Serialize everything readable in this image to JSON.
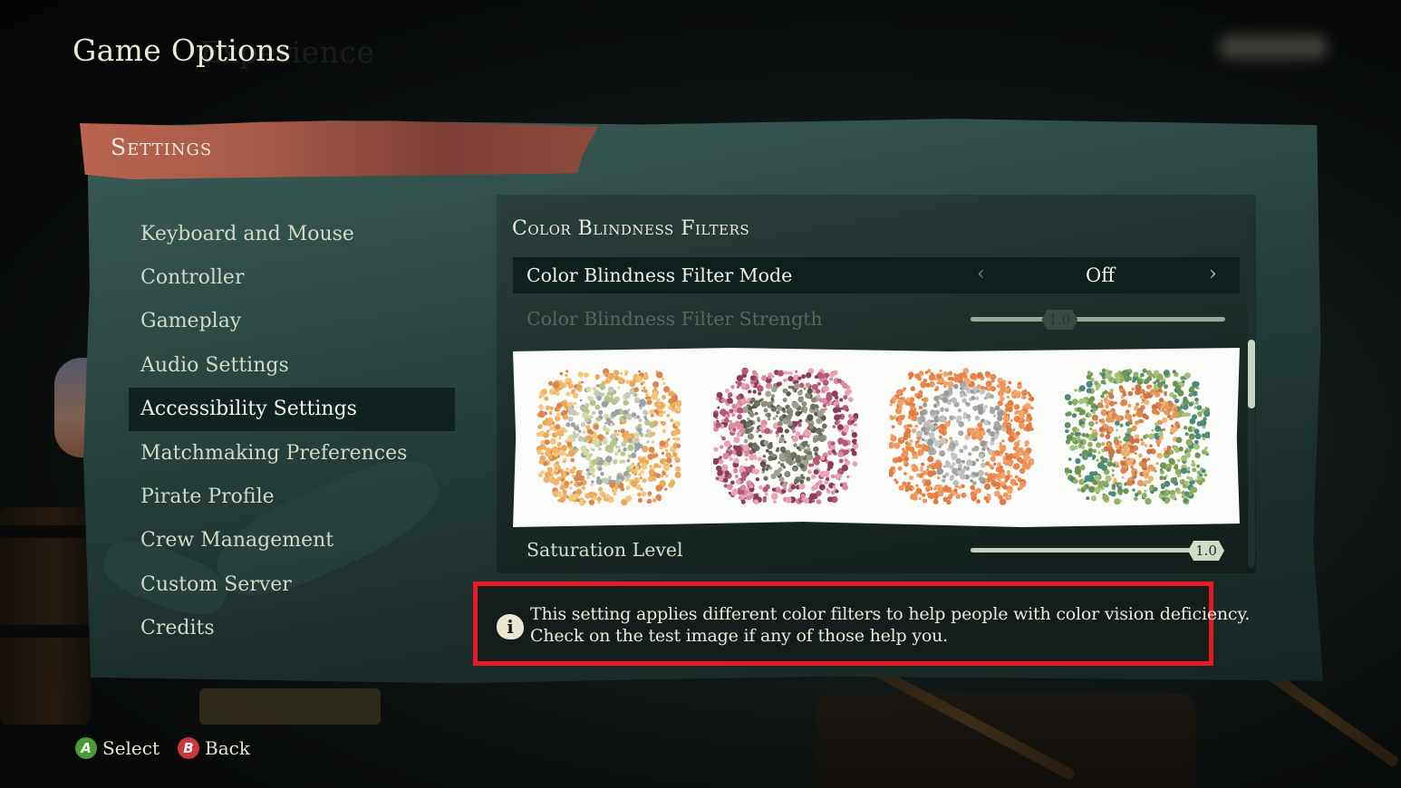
{
  "header": {
    "title": "Game Options",
    "ghost_title": "Experience"
  },
  "panel": {
    "banner_label": "Settings"
  },
  "sidebar": {
    "items": [
      {
        "label": "Keyboard and Mouse",
        "active": false
      },
      {
        "label": "Controller",
        "active": false
      },
      {
        "label": "Gameplay",
        "active": false
      },
      {
        "label": "Audio Settings",
        "active": false
      },
      {
        "label": "Accessibility Settings",
        "active": true
      },
      {
        "label": "Matchmaking Preferences",
        "active": false
      },
      {
        "label": "Pirate Profile",
        "active": false
      },
      {
        "label": "Crew Management",
        "active": false
      },
      {
        "label": "Custom Server",
        "active": false
      },
      {
        "label": "Credits",
        "active": false
      }
    ]
  },
  "content": {
    "section_title": "Color Blindness Filters",
    "filter_mode": {
      "label": "Color Blindness Filter Mode",
      "value": "Off",
      "prev_icon": "chevron-left",
      "next_icon": "chevron-right"
    },
    "filter_strength": {
      "label": "Color Blindness Filter Strength",
      "value": "1.0",
      "fraction": 0.35,
      "enabled": false
    },
    "test_image": {
      "plates": [
        {
          "name": "plate-yellow",
          "bg": [
            "#f5c77a",
            "#f2b366",
            "#e9a95a",
            "#d9874f"
          ],
          "fg": [
            "#d8d9a0",
            "#c4c9b8",
            "#b6c38a",
            "#9aa1a8"
          ]
        },
        {
          "name": "plate-pink",
          "bg": [
            "#e8a4b4",
            "#d98aa0",
            "#b45a78",
            "#8a3c5c"
          ],
          "fg": [
            "#6f6f62",
            "#8a8a7a",
            "#575a4e",
            "#a0a08e"
          ]
        },
        {
          "name": "plate-orange",
          "bg": [
            "#f0965a",
            "#e98548",
            "#f3a46a",
            "#df7c40"
          ],
          "fg": [
            "#a8a8a6",
            "#bdbdbb",
            "#999998",
            "#c8c6c3"
          ]
        },
        {
          "name": "plate-green",
          "bg": [
            "#a7c37a",
            "#8fae62",
            "#4d8a7a",
            "#6f9552"
          ],
          "fg": [
            "#e59a5a",
            "#d78550",
            "#c8734a",
            "#f0b070"
          ]
        }
      ]
    },
    "saturation": {
      "label": "Saturation Level",
      "value": "1.0",
      "fraction": 1.0
    }
  },
  "info": {
    "icon": "info-icon",
    "line1": "This setting applies different color filters to help people with color vision deficiency.",
    "line2": "Check on the test image if any of those help you.",
    "highlight_color": "#e41b23"
  },
  "footer": {
    "select": {
      "button": "A",
      "label": "Select",
      "color": "#4a9a3a"
    },
    "back": {
      "button": "B",
      "label": "Back",
      "color": "#c9363d"
    }
  }
}
